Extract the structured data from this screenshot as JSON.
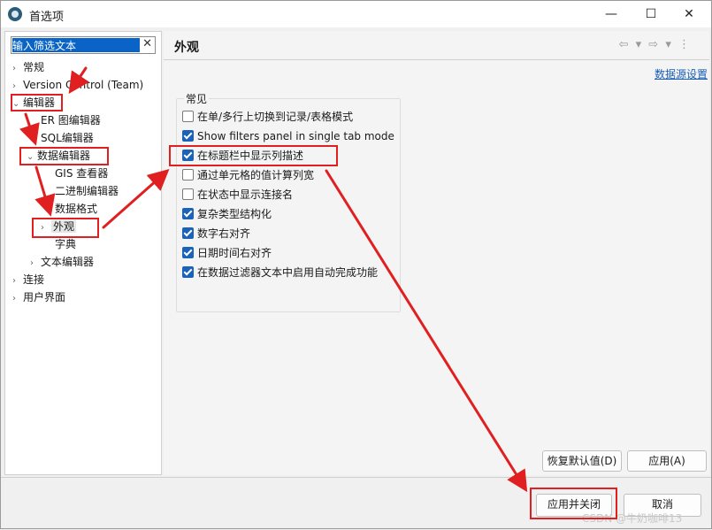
{
  "window": {
    "title": "首选项",
    "minimize_icon": "—",
    "maximize_icon": "☐",
    "close_icon": "✕"
  },
  "left_panel": {
    "filter": {
      "value": "输入筛选文本",
      "clear_icon": "✕"
    },
    "tree": [
      {
        "label": "常规",
        "twisty": "›",
        "level": 0
      },
      {
        "label": "Version Control (Team)",
        "twisty": "›",
        "level": 0
      },
      {
        "label": "编辑器",
        "twisty": "⌄",
        "level": 0,
        "expanded": true
      },
      {
        "label": "ER 图编辑器",
        "twisty": "",
        "level": 1
      },
      {
        "label": "SQL编辑器",
        "twisty": "›",
        "level": 1
      },
      {
        "label": "数据编辑器",
        "twisty": "⌄",
        "level": 1,
        "expanded": true
      },
      {
        "label": "GIS 查看器",
        "twisty": "",
        "level": 2
      },
      {
        "label": "二进制编辑器",
        "twisty": "",
        "level": 2
      },
      {
        "label": "数据格式",
        "twisty": "",
        "level": 2
      },
      {
        "label": "外观",
        "twisty": "›",
        "level": 2,
        "selected": true
      },
      {
        "label": "字典",
        "twisty": "",
        "level": 2
      },
      {
        "label": "文本编辑器",
        "twisty": "›",
        "level": 1
      },
      {
        "label": "连接",
        "twisty": "›",
        "level": 0
      },
      {
        "label": "用户界面",
        "twisty": "›",
        "level": 0
      }
    ]
  },
  "right_panel": {
    "title": "外观",
    "nav_icons": "⇦ ▾ ⇨ ▾ ⋮",
    "datasource_link": "数据源设置",
    "group_label": "常见",
    "options": [
      {
        "label": "在单/多行上切换到记录/表格模式",
        "checked": false
      },
      {
        "label": "Show filters panel in single tab mode",
        "checked": true
      },
      {
        "label": "在标题栏中显示列描述",
        "checked": true
      },
      {
        "label": "通过单元格的值计算列宽",
        "checked": false
      },
      {
        "label": "在状态中显示连接名",
        "checked": false
      },
      {
        "label": "复杂类型结构化",
        "checked": true
      },
      {
        "label": "数字右对齐",
        "checked": true
      },
      {
        "label": "日期时间右对齐",
        "checked": true
      },
      {
        "label": "在数据过滤器文本中启用自动完成功能",
        "checked": true
      }
    ],
    "restore_button": "恢复默认值(D)",
    "apply_button": "应用(A)"
  },
  "footer": {
    "apply_close_button": "应用并关闭",
    "cancel_button": "取消",
    "watermark": "CSDN @牛奶咖啡13"
  },
  "colors": {
    "annotation_red": "#e02020",
    "checkbox_blue": "#1a63b8",
    "link_blue": "#1a5fb4"
  }
}
